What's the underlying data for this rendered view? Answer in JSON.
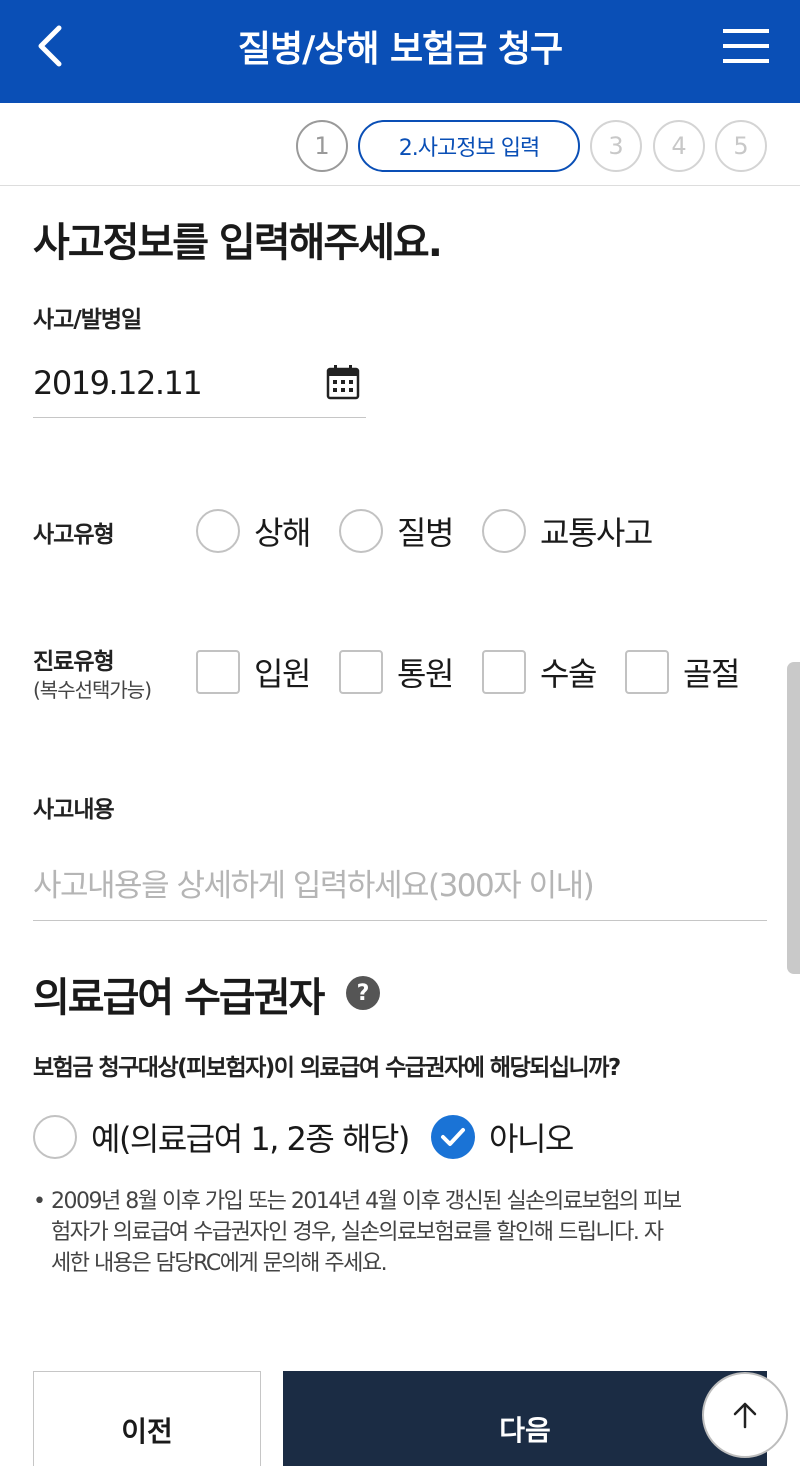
{
  "header": {
    "title": "질병/상해 보험금 청구",
    "back_icon": "chevron-left-icon",
    "menu_icon": "hamburger-menu-icon"
  },
  "stepper": {
    "steps": [
      {
        "label": "1",
        "state": "done"
      },
      {
        "label": "2.사고정보 입력",
        "state": "active"
      },
      {
        "label": "3",
        "state": "upcoming"
      },
      {
        "label": "4",
        "state": "upcoming"
      },
      {
        "label": "5",
        "state": "upcoming"
      }
    ]
  },
  "form": {
    "title": "사고정보를 입력해주세요.",
    "date": {
      "label": "사고/발병일",
      "value": "2019.12.11",
      "icon": "calendar-icon"
    },
    "accident_type": {
      "label": "사고유형",
      "options": [
        {
          "label": "상해",
          "checked": false
        },
        {
          "label": "질병",
          "checked": false
        },
        {
          "label": "교통사고",
          "checked": false
        }
      ]
    },
    "treatment_type": {
      "label": "진료유형",
      "sublabel": "(복수선택가능)",
      "options": [
        {
          "label": "입원",
          "checked": false
        },
        {
          "label": "통원",
          "checked": false
        },
        {
          "label": "수술",
          "checked": false
        },
        {
          "label": "골절",
          "checked": false
        }
      ]
    },
    "details": {
      "label": "사고내용",
      "placeholder": "사고내용을 상세하게 입력하세요(300자 이내)"
    }
  },
  "medical_aid": {
    "title": "의료급여 수급권자",
    "help_icon": "question-mark-icon",
    "help_symbol": "?",
    "question": "보험금 청구대상(피보험자)이 의료급여 수급권자에 해당되십니까?",
    "options": [
      {
        "label": "예(의료급여 1, 2종 해당)",
        "checked": false
      },
      {
        "label": "아니오",
        "checked": true
      }
    ],
    "note_bullet": "•",
    "note_lines": [
      "2009년 8월 이후 가입 또는 2014년 4월 이후 갱신된 실손의료보험의 피보",
      "험자가 의료급여 수급권자인 경우, 실손의료보험료를 할인해 드립니다. 자",
      "세한 내용은 담당RC에게 문의해 주세요."
    ]
  },
  "buttons": {
    "prev": "이전",
    "next": "다음",
    "scroll_top_icon": "arrow-up-icon"
  },
  "colors": {
    "brand_blue": "#0a4fb6",
    "check_blue": "#1a73d6",
    "next_button": "#1b2c44"
  }
}
